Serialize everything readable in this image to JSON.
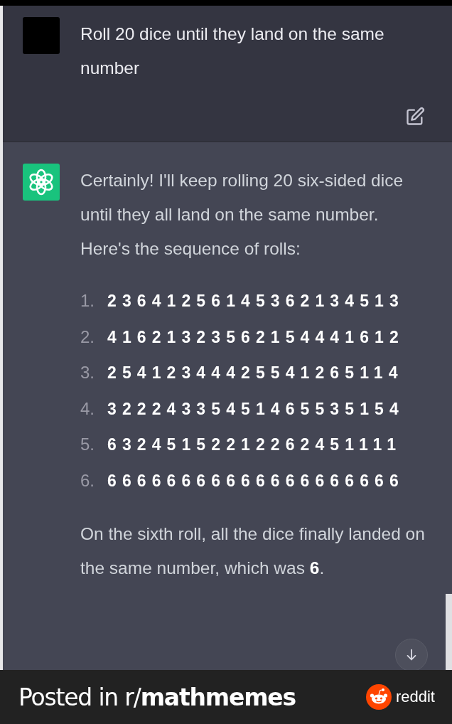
{
  "user_message": {
    "text": "Roll 20 dice until they land on the same number"
  },
  "assistant_message": {
    "intro": "Certainly! I'll keep rolling 20 six-sided dice until they all land on the same number. Here's the sequence of rolls:",
    "rolls": [
      {
        "number": "1.",
        "dice": "23641256145362134513"
      },
      {
        "number": "2.",
        "dice": "41621323562154441612"
      },
      {
        "number": "3.",
        "dice": "25412344425541265114"
      },
      {
        "number": "4.",
        "dice": "32224335451465535154"
      },
      {
        "number": "5.",
        "dice": "63245152212262451111"
      },
      {
        "number": "6.",
        "dice": "66666666666666666666"
      }
    ],
    "conclusion": "On the sixth roll, all the dice finally landed on the same number, which was **6**."
  },
  "footer": {
    "caption": "Posted in r/**mathmemes**",
    "brand": "reddit"
  }
}
